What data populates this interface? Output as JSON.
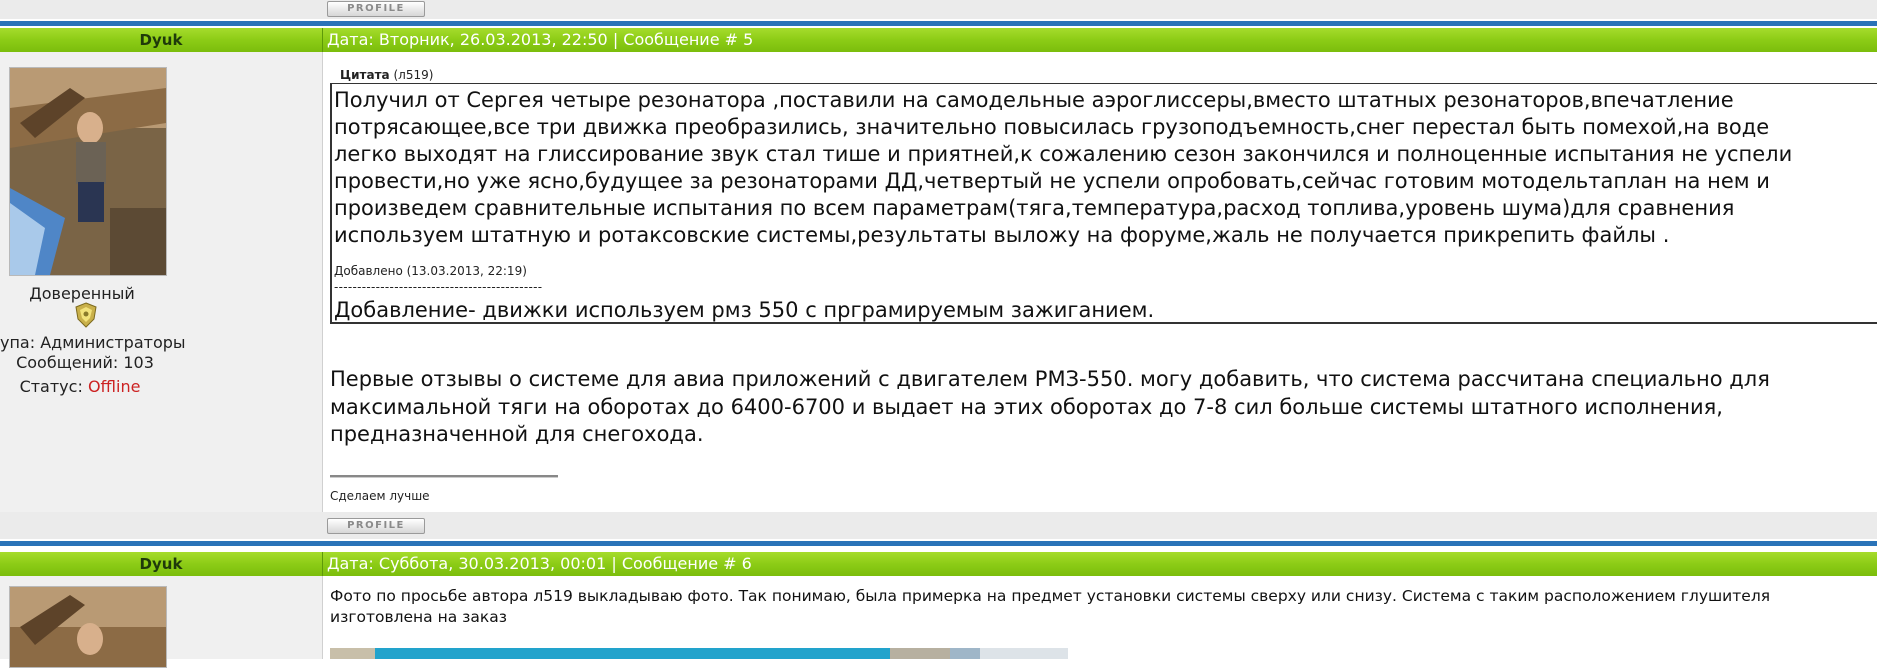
{
  "profile_button_label": "PROFILE",
  "posts": [
    {
      "author": "Dyuk",
      "header": "Дата: Вторник, 26.03.2013, 22:50 | Сообщение # 5",
      "rank": "Доверенный",
      "group": "упа: Администраторы",
      "messages": "Сообщений: 103",
      "status_label": "Статус:",
      "status_value": "Offline",
      "quote_label": "Цитата",
      "quote_author": "(л519)",
      "quote_lines": [
        "Получил от Сергея четыре резонатора ,поставили на самодельные аэроглиссеры,вместо штатных резонаторов,впечатление",
        "потрясающее,все три движка преобразились, значительно повысилась грузоподъемность,снег перестал быть помехой,на воде",
        "легко выходят на глиссирование звук стал тише и приятней,к сожалению сезон закончился и полноценные испытания не успели",
        "провести,но уже ясно,будущее за резонаторами ДД,четвертый не успели опробовать,сейчас готовим мотодельтаплан на нем и",
        "произведем сравнительные испытания по всем параметрам(тяга,температура,расход топлива,уровень шума)для сравнения",
        "используем штатную и ротаксовские системы,результаты выложу на форуме,жаль не получается прикрепить файлы ."
      ],
      "added_label": "Добавлено (13.03.2013, 22:19)",
      "separator": "---------------------------------------------",
      "added_text": "Добавление- движки используем рмз 550 с прграмируемым зажиганием.",
      "body_lines": [
        "Первые отзывы о системе для авиа приложений с двигателем РМЗ-550. могу добавить, что система рассчитана специально для",
        "максимальной тяги на оборотах до 6400-6700 и выдает на этих оборотах до 7-8 сил больше системы штатного исполнения,",
        "предназначенной для снегохода."
      ],
      "signature": "Сделаем лучше"
    },
    {
      "author": "Dyuk",
      "header": "Дата: Суббота, 30.03.2013, 00:01 | Сообщение # 6",
      "body_lines": [
        "Фото по просьбе автора л519 выкладываю фото. Так понимаю, была примерка на предмет установки системы сверху или снизу. Система с таким расположением глушителя",
        "изготовлена на заказ"
      ]
    }
  ],
  "colors": {
    "header_green": "#8ccc16",
    "header_blue_line": "#2a73b8",
    "strip_gray": "#ebebeb",
    "left_panel_gray": "#f0f0f0",
    "offline_red": "#cc2222"
  }
}
